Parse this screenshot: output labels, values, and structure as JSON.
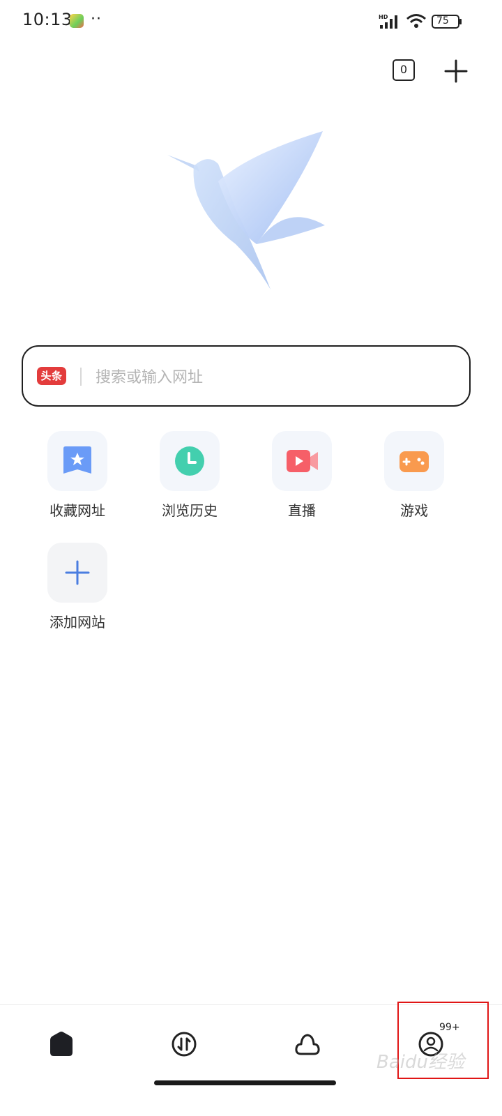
{
  "status_bar": {
    "time": "10:13",
    "dots": "··",
    "battery": "75",
    "network_label": "HD"
  },
  "toolbar": {
    "tab_count": "0"
  },
  "search": {
    "engine_label": "头条",
    "placeholder": "搜索或输入网址"
  },
  "shortcuts": [
    {
      "label": "收藏网址",
      "icon": "bookmark-star-icon",
      "color": "#5b8ff5"
    },
    {
      "label": "浏览历史",
      "icon": "clock-icon",
      "color": "#3fcfb0"
    },
    {
      "label": "直播",
      "icon": "video-camera-icon",
      "color": "#f45a63"
    },
    {
      "label": "游戏",
      "icon": "gamepad-icon",
      "color": "#f7944a"
    },
    {
      "label": "添加网站",
      "icon": "plus-icon",
      "color": "#4a7de0"
    }
  ],
  "bottom_nav": {
    "items": [
      "home-icon",
      "transfer-icon",
      "cloud-icon",
      "profile-icon"
    ],
    "badge": "99+"
  },
  "watermark": "Baidu经验"
}
